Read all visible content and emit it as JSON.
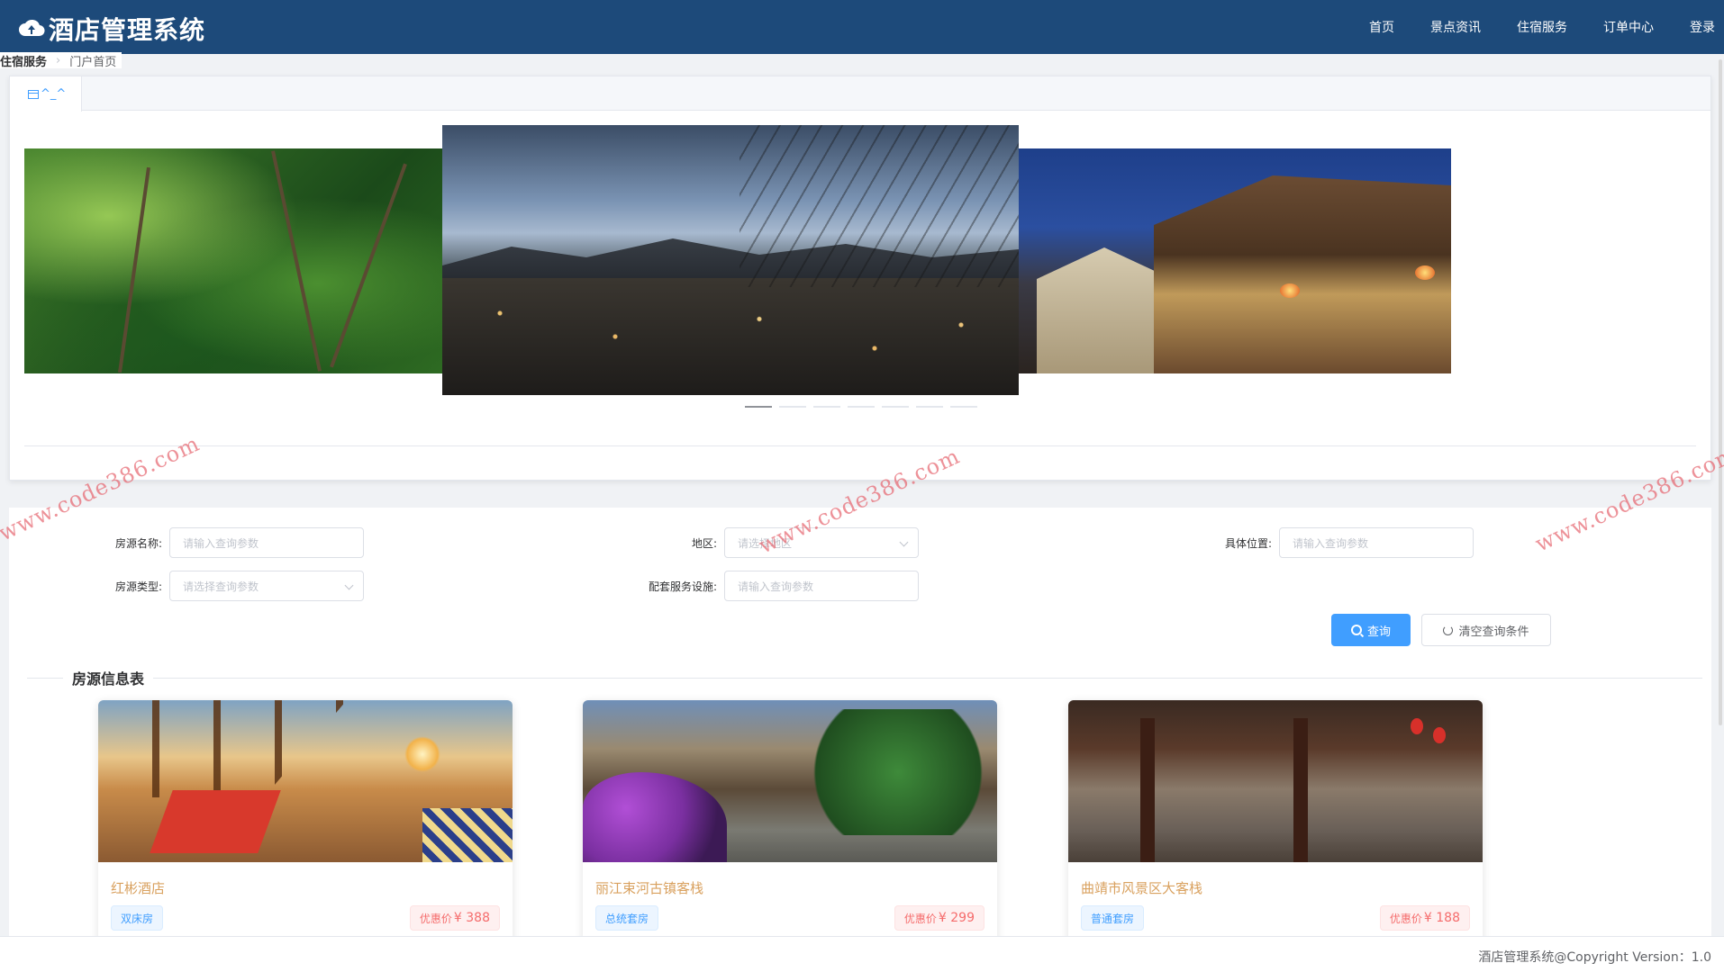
{
  "app": {
    "title": "酒店管理系统"
  },
  "nav": {
    "items": [
      {
        "label": "首页"
      },
      {
        "label": "景点资讯"
      },
      {
        "label": "住宿服务"
      },
      {
        "label": "订单中心"
      },
      {
        "label": "登录"
      }
    ]
  },
  "breadcrumb": {
    "first": "住宿服务",
    "second": "门户首页"
  },
  "tab": {
    "label": "^_^"
  },
  "carousel": {
    "dot_count": 7,
    "active_index": 0
  },
  "filters": {
    "name_label": "房源名称:",
    "name_placeholder": "请输入查询参数",
    "region_label": "地区:",
    "region_placeholder": "请选择地区",
    "location_label": "具体位置:",
    "location_placeholder": "请输入查询参数",
    "type_label": "房源类型:",
    "type_placeholder": "请选择查询参数",
    "facility_label": "配套服务设施:",
    "facility_placeholder": "请输入查询参数",
    "query_button": "查询",
    "clear_button": "清空查询条件"
  },
  "section": {
    "title": "房源信息表"
  },
  "listings": [
    {
      "name": "红彬酒店",
      "tag": "双床房",
      "price_label": "优惠价",
      "price": "¥ 388"
    },
    {
      "name": "丽江束河古镇客栈",
      "tag": "总统套房",
      "price_label": "优惠价",
      "price": "¥ 299"
    },
    {
      "name": "曲靖市风景区大客栈",
      "tag": "普通套房",
      "price_label": "优惠价",
      "price": "¥ 188"
    }
  ],
  "footer": {
    "text": "酒店管理系统@Copyright Version：1.0"
  },
  "watermark": {
    "text": "www.code386.com"
  },
  "colors": {
    "header_bg": "#1d4a7a",
    "primary": "#409eff",
    "price": "#f56c6c",
    "listing_name": "#d9a15f"
  }
}
